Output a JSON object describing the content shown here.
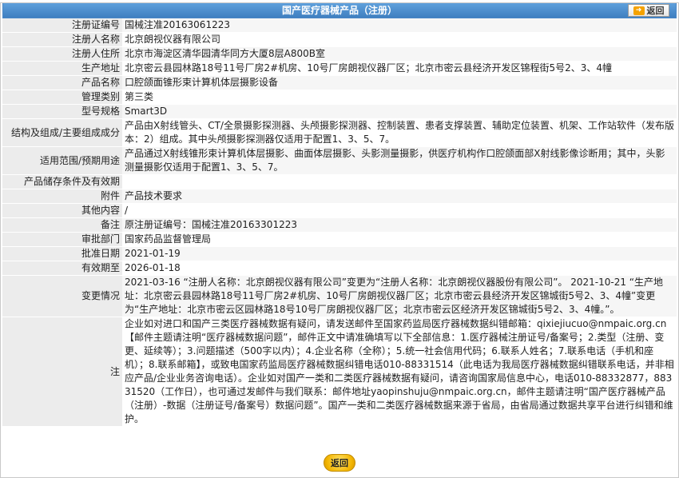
{
  "header": {
    "title": "国产医疗器械产品（注册）",
    "back_label": "返回"
  },
  "rows": [
    {
      "label": "注册证编号",
      "value": "国械注准20163061223"
    },
    {
      "label": "注册人名称",
      "value": "北京朗视仪器有限公司"
    },
    {
      "label": "注册人住所",
      "value": "北京市海淀区清华园清华同方大厦8层A800B室"
    },
    {
      "label": "生产地址",
      "value": "北京密云县园林路18号11号厂房2#机房、10号厂房朗视仪器厂区；北京市密云县经济开发区锦程街5号2、3、4幢"
    },
    {
      "label": "产品名称",
      "value": "口腔颌面锥形束计算机体层摄影设备"
    },
    {
      "label": "管理类别",
      "value": "第三类"
    },
    {
      "label": "型号规格",
      "value": "Smart3D"
    },
    {
      "label": "结构及组成/主要组成成分",
      "value": "产品由X射线管头、CT/全景摄影探测器、头颅摄影探测器、控制装置、患者支撑装置、辅助定位装置、机架、工作站软件（发布版本：2）组成。其中头颅摄影探测器仅适用于配置1、3、5、7。"
    },
    {
      "label": "适用范围/预期用途",
      "value": "产品通过X射线锥形束计算机体层摄影、曲面体层摄影、头影测量摄影，供医疗机构作口腔颌面部X射线影像诊断用；其中，头影测量摄影仅适用于配置1、3、5、7。"
    },
    {
      "label": "产品储存条件及有效期",
      "value": ""
    },
    {
      "label": "附件",
      "value": "产品技术要求"
    },
    {
      "label": "其他内容",
      "value": "/"
    },
    {
      "label": "备注",
      "value": "原注册证编号：国械注准20163301223"
    },
    {
      "label": "审批部门",
      "value": "国家药品监督管理局"
    },
    {
      "label": "批准日期",
      "value": "2021-01-19"
    },
    {
      "label": "有效期至",
      "value": "2026-01-18"
    },
    {
      "label": "变更情况",
      "value": "2021-03-16 “注册人名称：北京朗视仪器有限公司”变更为“注册人名称：北京朗视仪器股份有限公司”。 2021-10-21 “生产地址：北京密云县园林路18号11号厂房2#机房、10号厂房朗视仪器厂区；北京市密云县经济开发区锦城街5号2、3、4幢”变更为“生产地址：北京市密云区园林路18号10号厂房朗视仪器厂区；北京市密云区经济开发区锦城街5号2、3、4幢。”。"
    },
    {
      "label": "注",
      "value": "企业如对进口和国产三类医疗器械数据有疑问，请发送邮件至国家药监局医疗器械数据纠错邮箱：qixiejiucuo@nmpaic.org.cn【邮件主题请注明“医疗器械数据问题”，邮件正文中请准确填写以下全部信息：1.医疗器械注册证号/备案号；2.类型（注册、变更、延续等）；3.问题描述（500字以内）；4.企业名称（全称）；5.统一社会信用代码；6.联系人姓名；7.联系电话（手机和座机）；8.联系邮箱】，或致电国家药监局医疗器械数据纠错电话010-88331514（此电话为我局医疗器械数据纠错联系电话，并非相应产品/企业业务咨询电话）。企业如对国产一类和二类医疗器械数据有疑问，请咨询国家局信息中心，电话010-88332877，88331520（工作日），也可通过发邮件与我们联系：邮件地址yaopinshuju@nmpaic.org.cn，邮件主题请注明“国产医疗器械产品（注册）-数据（注册证号/备案号）数据问题”。国产一类和二类医疗器械数据来源于省局，由省局通过数据共享平台进行纠错和维护。"
    }
  ],
  "footer": {
    "back_label": "返回"
  }
}
